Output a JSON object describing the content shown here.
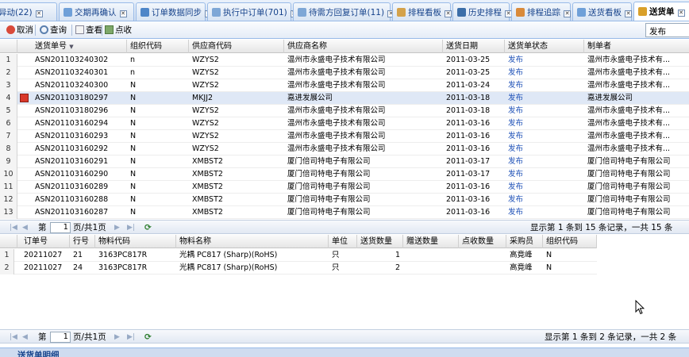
{
  "tabs": [
    {
      "label": "异动(22)",
      "icon": "page-icon"
    },
    {
      "label": "交期再确认",
      "icon": "refresh-icon"
    },
    {
      "label": "订单数据同步",
      "icon": "sync-icon"
    },
    {
      "label": "执行中订单(701)",
      "icon": "page-icon"
    },
    {
      "label": "待需方回复订单(11)",
      "icon": "page-icon"
    },
    {
      "label": "排程看板",
      "icon": "board-icon"
    },
    {
      "label": "历史排程",
      "icon": "history-icon"
    },
    {
      "label": "排程追踪",
      "icon": "track-icon"
    },
    {
      "label": "送货看板",
      "icon": "board-icon"
    },
    {
      "label": "送货单",
      "icon": "delivery-icon",
      "active": true
    }
  ],
  "toolbar": {
    "cancel": "取消",
    "query": "查询",
    "view": "查看",
    "receive": "点收",
    "filter_value": "发布"
  },
  "top_grid": {
    "headers": [
      "送货单号",
      "组织代码",
      "供应商代码",
      "供应商名称",
      "送货日期",
      "送货单状态",
      "制单者"
    ],
    "rows": [
      {
        "n": "1",
        "no": "ASN201103240302",
        "org": "n",
        "sup": "WZYS2",
        "name": "温州市永盛电子技术有限公司",
        "date": "2011-03-25",
        "status": "发布",
        "maker": "温州市永盛电子技术有..."
      },
      {
        "n": "2",
        "no": "ASN201103240301",
        "org": "n",
        "sup": "WZYS2",
        "name": "温州市永盛电子技术有限公司",
        "date": "2011-03-25",
        "status": "发布",
        "maker": "温州市永盛电子技术有..."
      },
      {
        "n": "3",
        "no": "ASN201103240300",
        "org": "N",
        "sup": "WZYS2",
        "name": "温州市永盛电子技术有限公司",
        "date": "2011-03-24",
        "status": "发布",
        "maker": "温州市永盛电子技术有..."
      },
      {
        "n": "4",
        "no": "ASN201103180297",
        "org": "N",
        "sup": "MKJJ2",
        "name": "嘉进发展公司",
        "date": "2011-03-18",
        "status": "发布",
        "maker": "嘉进发展公司",
        "selected": true
      },
      {
        "n": "5",
        "no": "ASN201103180296",
        "org": "N",
        "sup": "WZYS2",
        "name": "温州市永盛电子技术有限公司",
        "date": "2011-03-18",
        "status": "发布",
        "maker": "温州市永盛电子技术有..."
      },
      {
        "n": "6",
        "no": "ASN201103160294",
        "org": "N",
        "sup": "WZYS2",
        "name": "温州市永盛电子技术有限公司",
        "date": "2011-03-16",
        "status": "发布",
        "maker": "温州市永盛电子技术有..."
      },
      {
        "n": "7",
        "no": "ASN201103160293",
        "org": "N",
        "sup": "WZYS2",
        "name": "温州市永盛电子技术有限公司",
        "date": "2011-03-16",
        "status": "发布",
        "maker": "温州市永盛电子技术有..."
      },
      {
        "n": "8",
        "no": "ASN201103160292",
        "org": "N",
        "sup": "WZYS2",
        "name": "温州市永盛电子技术有限公司",
        "date": "2011-03-16",
        "status": "发布",
        "maker": "温州市永盛电子技术有..."
      },
      {
        "n": "9",
        "no": "ASN201103160291",
        "org": "N",
        "sup": "XMBST2",
        "name": "厦门倍司特电子有限公司",
        "date": "2011-03-17",
        "status": "发布",
        "maker": "厦门倍司特电子有限公司"
      },
      {
        "n": "10",
        "no": "ASN201103160290",
        "org": "N",
        "sup": "XMBST2",
        "name": "厦门倍司特电子有限公司",
        "date": "2011-03-17",
        "status": "发布",
        "maker": "厦门倍司特电子有限公司"
      },
      {
        "n": "11",
        "no": "ASN201103160289",
        "org": "N",
        "sup": "XMBST2",
        "name": "厦门倍司特电子有限公司",
        "date": "2011-03-16",
        "status": "发布",
        "maker": "厦门倍司特电子有限公司"
      },
      {
        "n": "12",
        "no": "ASN201103160288",
        "org": "N",
        "sup": "XMBST2",
        "name": "厦门倍司特电子有限公司",
        "date": "2011-03-16",
        "status": "发布",
        "maker": "厦门倍司特电子有限公司"
      },
      {
        "n": "13",
        "no": "ASN201103160287",
        "org": "N",
        "sup": "XMBST2",
        "name": "厦门倍司特电子有限公司",
        "date": "2011-03-16",
        "status": "发布",
        "maker": "厦门倍司特电子有限公司"
      }
    ]
  },
  "top_paging": {
    "page_label": "第",
    "page_value": "1",
    "page_suffix": "页/共1页",
    "summary": "显示第 1 条到 15 条记录，一共 15 条"
  },
  "detail_grid": {
    "headers": [
      "订单号",
      "行号",
      "物料代码",
      "物料名称",
      "单位",
      "送货数量",
      "赠送数量",
      "点收数量",
      "采购员",
      "组织代码"
    ],
    "rows": [
      {
        "n": "1",
        "order": "20211027",
        "line": "21",
        "code": "3163PC817R",
        "name": "光耦 PC817 (Sharp)(RoHS)",
        "unit": "只",
        "qty": "1",
        "gift": "",
        "recv": "",
        "buyer": "高竟峰",
        "org": "N"
      },
      {
        "n": "2",
        "order": "20211027",
        "line": "24",
        "code": "3163PC817R",
        "name": "光耦 PC817 (Sharp)(RoHS)",
        "unit": "只",
        "qty": "2",
        "gift": "",
        "recv": "",
        "buyer": "高竟峰",
        "org": "N"
      }
    ]
  },
  "bottom_paging": {
    "page_label": "第",
    "page_value": "1",
    "page_suffix": "页/共1页",
    "summary": "显示第 1 条到 2 条记录，一共 2 条"
  },
  "bottom_tab": "送货单明细"
}
